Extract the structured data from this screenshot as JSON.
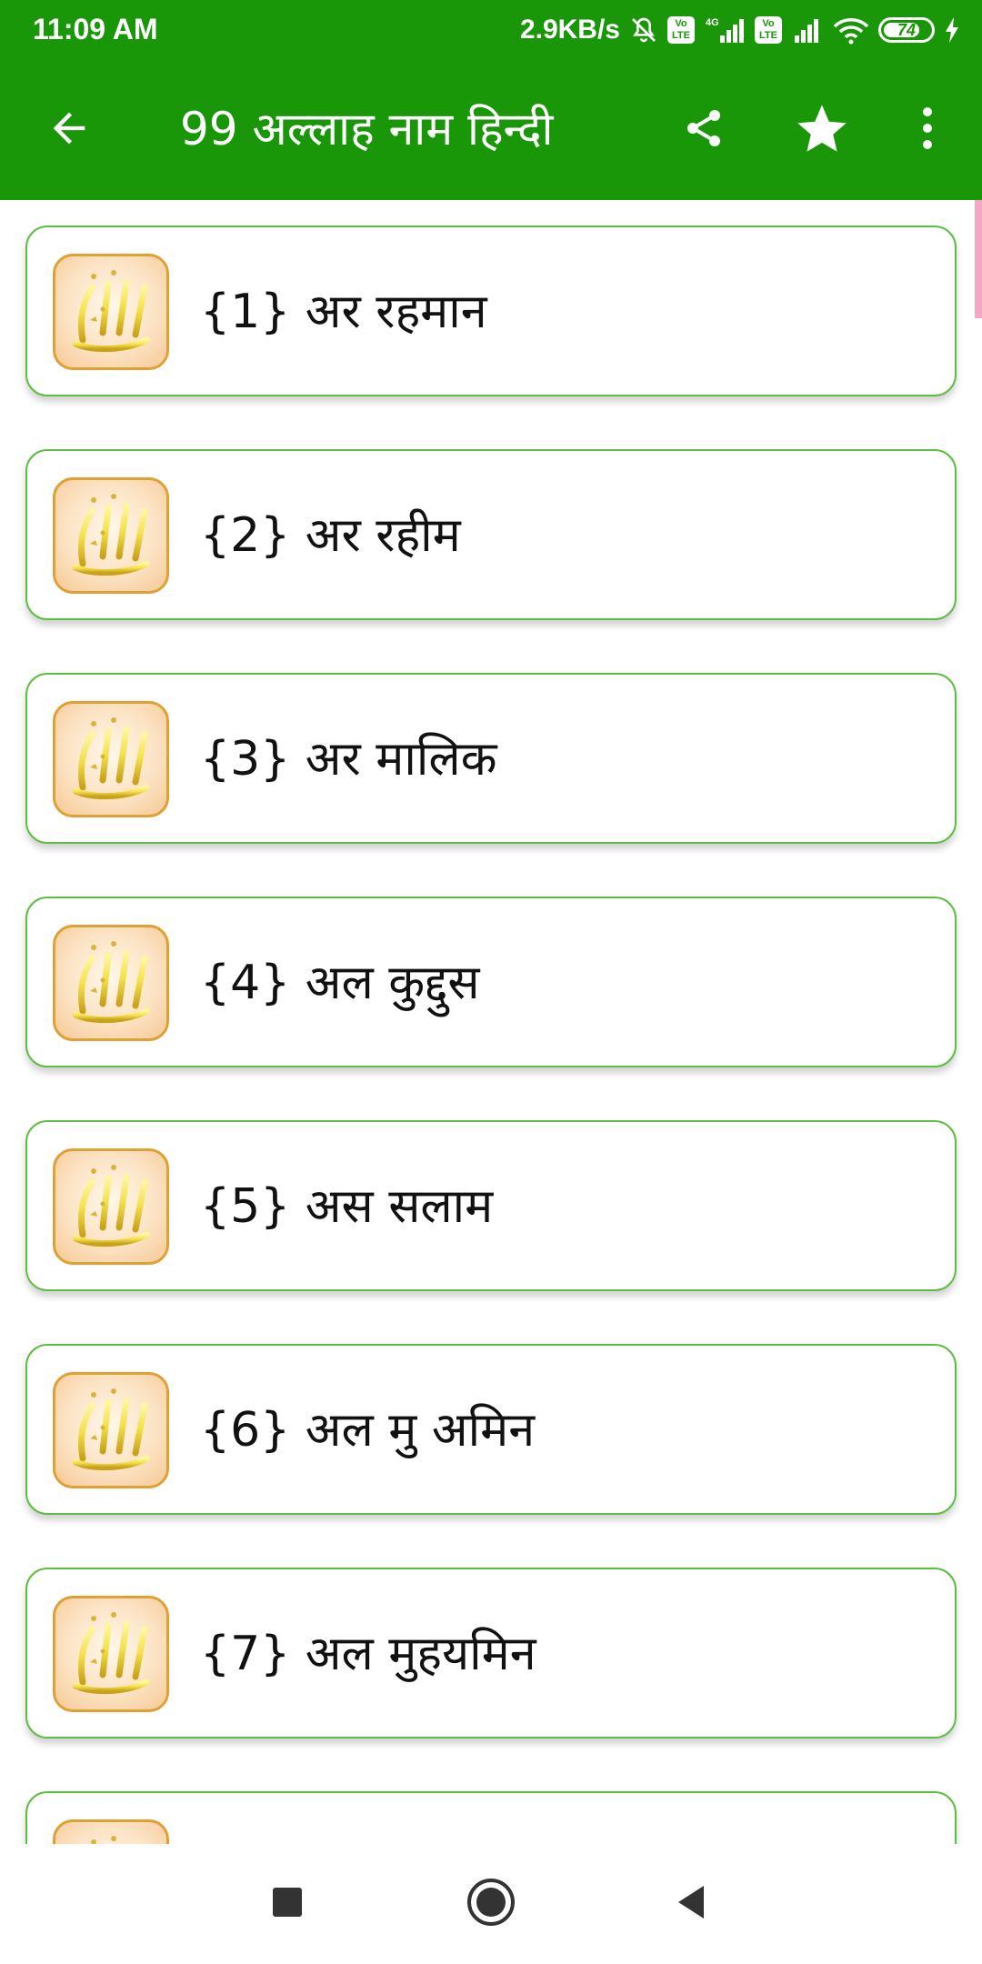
{
  "status_bar": {
    "time": "11:09 AM",
    "network_speed": "2.9KB/s",
    "sim1_badge": "Vo LTE",
    "network_type": "4G",
    "sim2_badge": "Vo LTE",
    "battery_level": "74",
    "icons": [
      "mute-icon",
      "volte-icon",
      "signal-icon",
      "wifi-icon",
      "battery-icon",
      "charging-icon"
    ]
  },
  "app_bar": {
    "title": "99 अल्लाह नाम हिन्दी",
    "icons": [
      "back-arrow-icon",
      "share-icon",
      "star-icon",
      "more-vert-icon"
    ]
  },
  "names": [
    {
      "label": "{1} अर रहमान"
    },
    {
      "label": "{2} अर रहीम"
    },
    {
      "label": "{3} अर मालिक"
    },
    {
      "label": "{4} अल कुद्दुस"
    },
    {
      "label": "{5} अस सलाम"
    },
    {
      "label": "{6} अल मु अमिन"
    },
    {
      "label": "{7} अल मुहयमिन"
    },
    {
      "label": ""
    }
  ],
  "nav_bar": {
    "icons": [
      "recents-square-icon",
      "home-circle-icon",
      "back-triangle-icon"
    ]
  },
  "colors": {
    "primary": "#1a9708",
    "card_border": "#5cbf42",
    "icon_border": "#e0a033",
    "scroll_indicator": "#f4a6c4"
  }
}
